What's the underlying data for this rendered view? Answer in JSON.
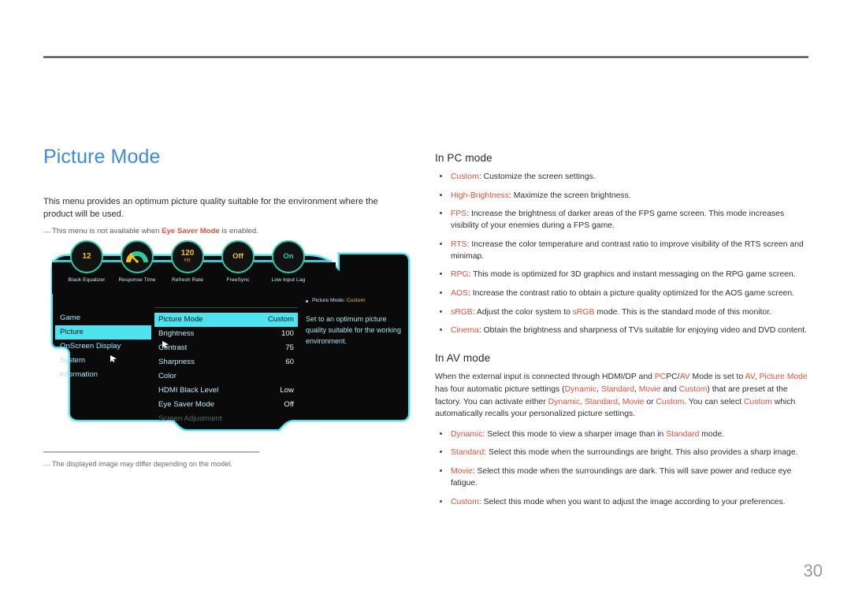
{
  "page": {
    "number": "30"
  },
  "left": {
    "title": "Picture Mode",
    "intro": "This menu provides an optimum picture quality suitable for the environment where the product will be used.",
    "note_prefix": "This menu is not available when ",
    "note_highlight": "Eye Saver Mode",
    "note_suffix": " is enabled.",
    "dash": "—",
    "footnote": "The displayed image may differ depending on the model."
  },
  "osd": {
    "icons": [
      {
        "label": "Black Equalizer",
        "value": "12",
        "unit": "",
        "type": "value"
      },
      {
        "label": "Response Time",
        "value": "",
        "unit": "",
        "type": "gauge"
      },
      {
        "label": "Refresh Rate",
        "value": "120",
        "unit": "Hz",
        "type": "value"
      },
      {
        "label": "FreeSync",
        "value": "Off",
        "unit": "",
        "type": "off"
      },
      {
        "label": "Low Input Lag",
        "value": "On",
        "unit": "",
        "type": "on"
      }
    ],
    "left_menu": [
      {
        "label": "Game",
        "selected": false
      },
      {
        "label": "Picture",
        "selected": true
      },
      {
        "label": "OnScreen Display",
        "selected": false
      },
      {
        "label": "System",
        "selected": false
      },
      {
        "label": "Information",
        "selected": false
      }
    ],
    "settings": [
      {
        "label": "Picture Mode",
        "value": "Custom",
        "selected": true,
        "dim": false
      },
      {
        "label": "Brightness",
        "value": "100",
        "selected": false,
        "dim": false
      },
      {
        "label": "Contrast",
        "value": "75",
        "selected": false,
        "dim": false
      },
      {
        "label": "Sharpness",
        "value": "60",
        "selected": false,
        "dim": false
      },
      {
        "label": "Color",
        "value": "",
        "selected": false,
        "dim": false
      },
      {
        "label": "HDMI Black Level",
        "value": "Low",
        "selected": false,
        "dim": false
      },
      {
        "label": "Eye Saver Mode",
        "value": "Off",
        "selected": false,
        "dim": false
      },
      {
        "label": "Screen Adjustment",
        "value": "",
        "selected": false,
        "dim": true
      }
    ],
    "hint_label": "Picture Mode:",
    "hint_value": "Custom",
    "hint_description": "Set to an optimum picture quality suitable for the working environment."
  },
  "right": {
    "pc_heading": "In PC mode",
    "pc_items": [
      {
        "term": "Custom",
        "text": ": Customize the screen settings."
      },
      {
        "term": "High-Brightness",
        "text": ": Maximize the screen brightness."
      },
      {
        "term": "FPS",
        "text": ": Increase the brightness of darker areas of the FPS game screen. This mode increases visibility of your enemies during a FPS game."
      },
      {
        "term": "RTS",
        "text": ": Increase the color temperature and contrast ratio to improve visibility of the RTS screen and minimap."
      },
      {
        "term": "RPG",
        "text": ": This mode is optimized for 3D graphics and instant messaging on the RPG game screen."
      },
      {
        "term": "AOS",
        "text": ": Increase the contrast ratio to obtain a picture quality optimized for the AOS game screen."
      },
      {
        "term": "sRGB",
        "text": ": Adjust the color system to sRGB mode. This is the standard mode of this monitor."
      },
      {
        "term": "Cinema",
        "text": ": Obtain the brightness and sharpness of TVs suitable for enjoying video and DVD content."
      }
    ],
    "av_heading": "In AV mode",
    "av_paragraph": "When the external input is connected through HDMI/DP and PC/AV Mode is set to AV, Picture Mode has four automatic picture settings (Dynamic, Standard, Movie and Custom) that are preset at the factory. You can activate either Dynamic, Standard, Movie or Custom. You can select Custom which automatically recalls your personalized picture settings.",
    "av_items": [
      {
        "term": "Dynamic",
        "text": ": Select this mode to view a sharper image than in Standard mode."
      },
      {
        "term": "Standard",
        "text": ": Select this mode when the surroundings are bright. This also provides a sharp image."
      },
      {
        "term": "Movie",
        "text": ": Select this mode when the surroundings are dark. This will save power and reduce eye fatigue."
      },
      {
        "term": "Custom",
        "text": ": Select this mode when you want to adjust the image according to your preferences."
      }
    ]
  },
  "colors": {
    "title_blue": "#3d8ce0",
    "accent_red": "#e8503a",
    "osd_cyan": "#4fe3f0",
    "osd_green": "#2fc9a0",
    "osd_yellow": "#f0c020"
  }
}
